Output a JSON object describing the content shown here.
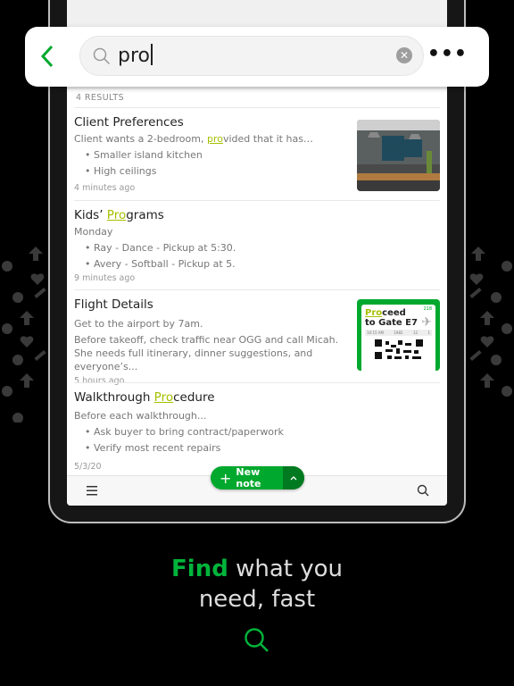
{
  "search": {
    "query": "pro"
  },
  "results_label": "4 RESULTS",
  "notes": [
    {
      "title_pre": "Client Preferences",
      "title_hl": "",
      "title_post": "",
      "snippet_pre": "Client wants a 2-bedroom, ",
      "snippet_hl": "pro",
      "snippet_post": "vided that it has…",
      "bullets": [
        "Smaller island kitchen",
        "High ceilings"
      ],
      "time": "4 minutes ago"
    },
    {
      "title_pre": "Kids’ ",
      "title_hl": "Pro",
      "title_post": "grams",
      "lines": [
        "Monday"
      ],
      "bullets": [
        "Ray - Dance - Pickup at 5:30.",
        "Avery - Softball - Pickup at 5."
      ],
      "time": "9 minutes ago"
    },
    {
      "title_pre": "Flight Details",
      "lines": [
        "Get to the airport by 7am.",
        "Before takeoff, check traffic near OGG and call Micah. She needs full itinerary, dinner suggestions, and everyone’s..."
      ],
      "time": "5 hours ago",
      "ticket": {
        "hl": "Pro",
        "post": "ceed",
        "line2": "to Gate E7",
        "num": "218",
        "info": [
          "10:15 AM",
          "1982",
          "12",
          "1"
        ]
      }
    },
    {
      "title_pre": "Walkthrough ",
      "title_hl": "Pro",
      "title_post": "cedure",
      "lines": [
        "Before each walkthrough..."
      ],
      "bullets": [
        "Ask buyer to bring contract/paperwork",
        "Verify most recent repairs"
      ],
      "time": "5/3/20"
    }
  ],
  "new_note_label": "New note",
  "tagline": {
    "highlight": "Find",
    "rest1": " what you",
    "line2": "need, fast"
  },
  "colors": {
    "accent": "#00a82d",
    "highlight": "#a6c000",
    "background": "#000000"
  }
}
